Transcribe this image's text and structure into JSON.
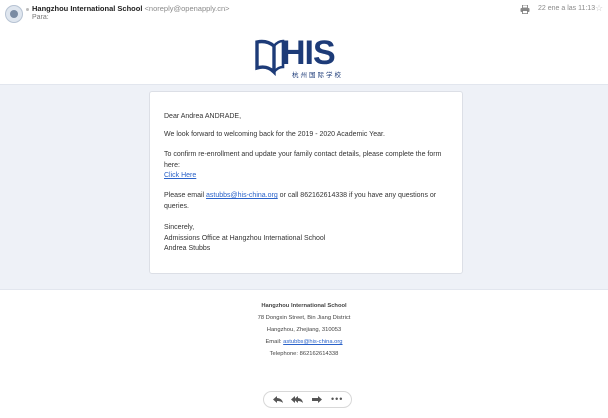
{
  "header": {
    "sender_name": "Hangzhou International School",
    "sender_email": "<noreply@openapply.cn>",
    "to_label": "Para:",
    "date": "22 ene a las 11:13"
  },
  "logo": {
    "text": "HIS",
    "subtitle": "杭州国际学校"
  },
  "message": {
    "greeting": "Dear Andrea ANDRADE,",
    "welcome": "We look forward to welcoming            back for the 2019 - 2020 Academic Year.",
    "instructions": "To confirm re-enrollment and update your family contact details, please complete the form here:",
    "click_here": "Click Here",
    "email_prefix": "Please email ",
    "email_link": "astubbs@his-china.org",
    "email_suffix": " or call 862162614338 if you have any questions or queries.",
    "closing": "Sincerely,",
    "signature_office": "Admissions Office at Hangzhou International School",
    "signature_name": "Andrea Stubbs"
  },
  "footer": {
    "school": "Hangzhou International School",
    "street": "78 Dongxin Street, Bin Jiang District",
    "city": "Hangzhou, Zhejiang, 310053",
    "email_label": "Email: ",
    "email_link": "astubbs@his-china.org",
    "telephone": "Telephone: 862162614338"
  },
  "actions": {
    "reply": "reply-icon",
    "reply_all": "reply-all-icon",
    "forward": "forward-icon",
    "more": "more-icon"
  },
  "colors": {
    "brand_navy": "#1d3b78",
    "link_blue": "#2a62c9",
    "band_bg": "#eef1f7"
  }
}
